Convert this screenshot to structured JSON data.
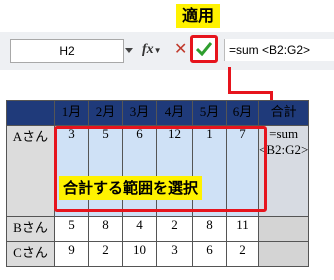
{
  "callouts": {
    "apply": "適用",
    "range": "合計する範囲を選択"
  },
  "formula_bar": {
    "name_box": "H2",
    "fx_label": "fx",
    "formula": "=sum <B2:G2>"
  },
  "table": {
    "headers": [
      "",
      "1月",
      "2月",
      "3月",
      "4月",
      "5月",
      "6月",
      "合計"
    ],
    "rows": [
      {
        "name": "Aさん",
        "values": [
          "3",
          "5",
          "6",
          "12",
          "1",
          "7"
        ],
        "total": "=sum <B2:G2>"
      },
      {
        "name": "Bさん",
        "values": [
          "5",
          "8",
          "4",
          "2",
          "8",
          "11"
        ],
        "total": ""
      },
      {
        "name": "Cさん",
        "values": [
          "9",
          "2",
          "10",
          "3",
          "6",
          "2"
        ],
        "total": ""
      }
    ]
  },
  "colors": {
    "header_bg": "#1f3a7a",
    "highlight": "#e6141d",
    "callout_bg": "#fff200",
    "selection_bg": "#cfe1f6"
  }
}
